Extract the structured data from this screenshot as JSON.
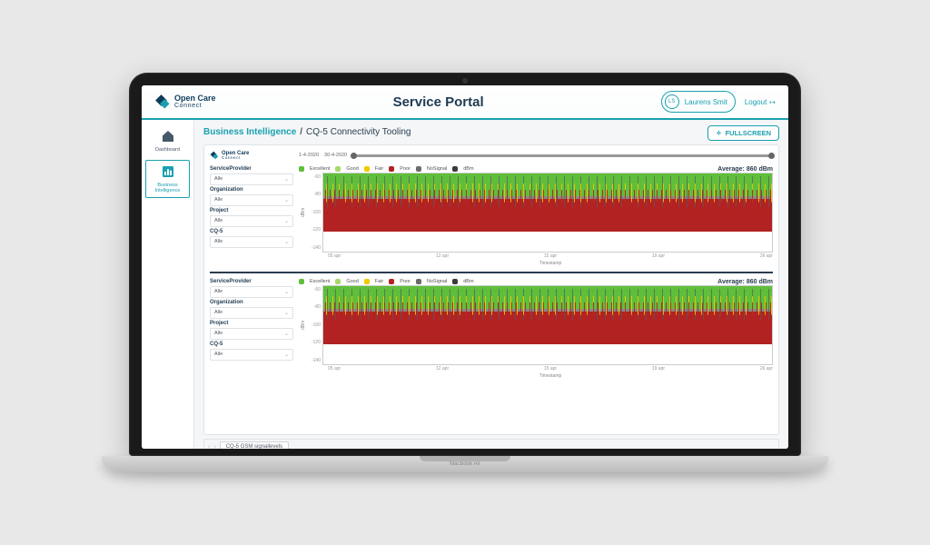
{
  "brand": {
    "top": "Open Care",
    "bottom": "Connect"
  },
  "header": {
    "title": "Service Portal",
    "user_initials": "LS",
    "user_name": "Laurens Smit",
    "logout_label": "Logout"
  },
  "sidebar": {
    "items": [
      {
        "label": "Dashboard",
        "icon": "home-icon"
      },
      {
        "label": "Business Intelligence",
        "icon": "chart-icon"
      }
    ],
    "active_index": 1
  },
  "breadcrumb": {
    "section": "Business Intelligence",
    "page": "CQ-5 Connectivity Tooling"
  },
  "fullscreen_button": "FULLSCREEN",
  "timeline": {
    "start": "1-4-2020",
    "end": "30-4-2020"
  },
  "filters": [
    {
      "label": "ServiceProvider",
      "value": "Alle"
    },
    {
      "label": "Organization",
      "value": "Alle"
    },
    {
      "label": "Project",
      "value": "Alle"
    },
    {
      "label": "CQ-5",
      "value": "Alle"
    }
  ],
  "legend": {
    "items": [
      {
        "name": "Excellent",
        "color": "#5fbf3a"
      },
      {
        "name": "Good",
        "color": "#a8d86a"
      },
      {
        "name": "Fair",
        "color": "#f2c900"
      },
      {
        "name": "Poor",
        "color": "#b22222"
      },
      {
        "name": "NoSignal",
        "color": "#6b6b6b"
      },
      {
        "name": "dBm",
        "color": "#3b3b3b"
      }
    ]
  },
  "charts": [
    {
      "average_label": "Average: 860 dBm"
    },
    {
      "average_label": "Average: 860 dBm"
    }
  ],
  "axes": {
    "ylabel": "dBm",
    "yticks": [
      "-60",
      "-80",
      "-100",
      "-120",
      "-140"
    ],
    "xlabel": "Timestamp",
    "xticks": [
      "05 apr",
      "12 apr",
      "15 apr",
      "19 apr",
      "26 apr"
    ]
  },
  "bottom_tab": "CQ-5 GSM signallevels",
  "laptop_label": "MacBook Air",
  "chart_data": {
    "type": "area",
    "series_stacked_categorical": [
      "Excellent",
      "Good",
      "Fair",
      "Poor",
      "NoSignal"
    ],
    "overlay_line": "dBm",
    "x_range": [
      "2020-04-01",
      "2020-04-30"
    ],
    "xticks": [
      "05 apr",
      "12 apr",
      "15 apr",
      "19 apr",
      "26 apr"
    ],
    "ylabel": "dBm",
    "yrange": [
      -140,
      -60
    ],
    "average_dBm": 860,
    "note": "Dense stacked GSM signal-quality bands over April 2020; exact per-timestamp values not legible at this resolution."
  }
}
